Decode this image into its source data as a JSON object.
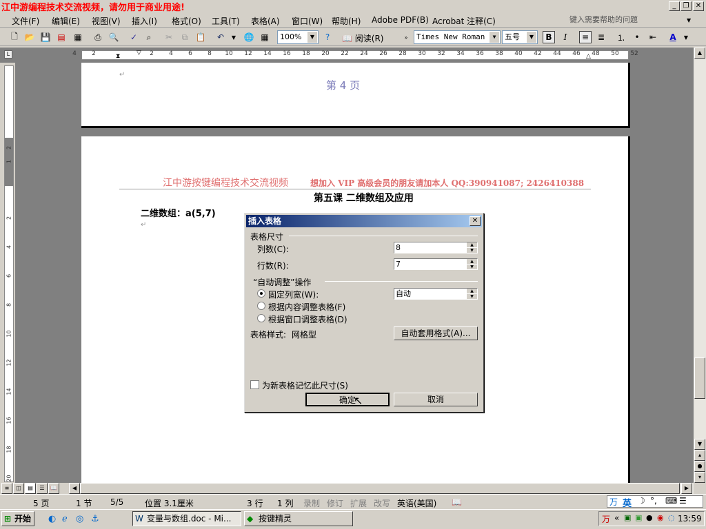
{
  "titlebar": {
    "watermark": "江中游编程技术交流视频，请勿用于商业用途!"
  },
  "menubar": {
    "items": [
      "文件(F)",
      "编辑(E)",
      "视图(V)",
      "插入(I)",
      "格式(O)",
      "工具(T)",
      "表格(A)",
      "窗口(W)",
      "帮助(H)",
      "Adobe PDF(B)",
      "Acrobat 注释(C)"
    ],
    "help_placeholder": "键入需要帮助的问题"
  },
  "toolbar": {
    "zoom": "100%",
    "read_label": "阅读(R)",
    "font": "Times New Roman",
    "size": "五号",
    "bold": "B",
    "italic": "I"
  },
  "ruler": {
    "ticks": [
      "4",
      "2",
      "2",
      "4",
      "6",
      "8",
      "10",
      "12",
      "14",
      "16",
      "18",
      "20",
      "22",
      "24",
      "26",
      "28",
      "30",
      "32",
      "34",
      "36",
      "38",
      "40",
      "42",
      "44",
      "46",
      "48",
      "50",
      "52"
    ]
  },
  "vruler": {
    "ticks": [
      "2",
      "1",
      "2",
      "4",
      "6",
      "8",
      "10",
      "12",
      "14",
      "16",
      "18",
      "20"
    ]
  },
  "document": {
    "footer_text": "第 4 页",
    "header_left": "江中游按键编程技术交流视频",
    "header_right": "想加入 VIP 高级会员的朋友请加本人 QQ:390941087; 2426410388",
    "lesson_title": "第五课  二维数组及应用",
    "line1": "二维数组：a(5,7)"
  },
  "dialog": {
    "title": "插入表格",
    "close": "✕",
    "size_group": "表格尺寸",
    "cols_label": "列数(C):",
    "cols_value": "8",
    "rows_label": "行数(R):",
    "rows_value": "7",
    "autofit_group": "“自动调整”操作",
    "fixed_label": "固定列宽(W):",
    "fixed_value": "自动",
    "content_label": "根据内容调整表格(F)",
    "window_label": "根据窗口调整表格(D)",
    "style_label": "表格样式:",
    "style_value": "网格型",
    "autoformat_button": "自动套用格式(A)...",
    "remember_label": "为新表格记忆此尺寸(S)",
    "ok": "确定",
    "cancel": "取消"
  },
  "statusbar": {
    "page": "5 页",
    "section": "1 节",
    "pages": "5/5",
    "position": "位置 3.1厘米",
    "row": "3 行",
    "col": "1 列",
    "rec": "录制",
    "trk": "修订",
    "ext": "扩展",
    "ovr": "改写",
    "lang": "英语(美国)"
  },
  "taskbar": {
    "start": "开始",
    "task1": "变量与数组.doc - Mi...",
    "task2": "按键精灵",
    "clock": "13:59",
    "ime": "英"
  }
}
